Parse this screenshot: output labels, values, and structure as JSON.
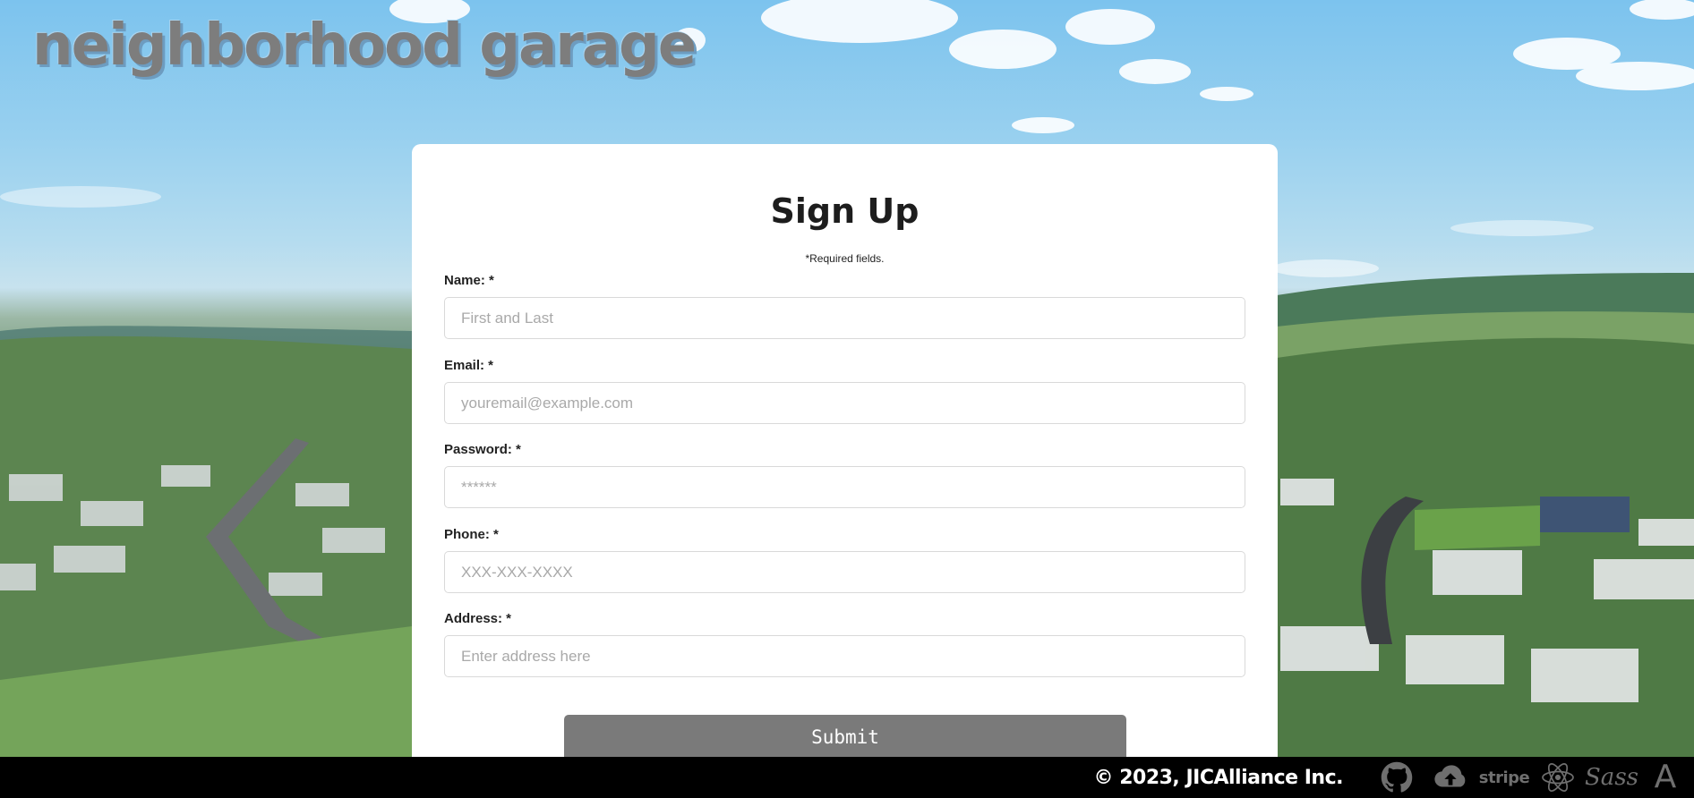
{
  "brand": {
    "title": "neighborhood garage"
  },
  "form": {
    "heading": "Sign Up",
    "required_note": "*Required fields.",
    "fields": [
      {
        "label": "Name: *",
        "placeholder": "First and Last"
      },
      {
        "label": "Email: *",
        "placeholder": "youremail@example.com"
      },
      {
        "label": "Password: *",
        "placeholder": "******"
      },
      {
        "label": "Phone: *",
        "placeholder": "XXX-XXX-XXXX"
      },
      {
        "label": "Address: *",
        "placeholder": "Enter address here"
      }
    ],
    "submit_label": "Submit"
  },
  "footer": {
    "copyright": "© 2023, JICAlliance Inc.",
    "icons": [
      "github-icon",
      "cloud-upload-icon",
      "stripe-icon",
      "react-icon",
      "sass-icon",
      "a-logo-icon"
    ],
    "stripe_text": "stripe",
    "sass_text": "Sass",
    "a_text": "A"
  },
  "colors": {
    "card_bg": "#ffffff",
    "submit_bg": "#7a7a7a",
    "footer_bg": "#000000",
    "brand_text": "#7d7d7d"
  }
}
